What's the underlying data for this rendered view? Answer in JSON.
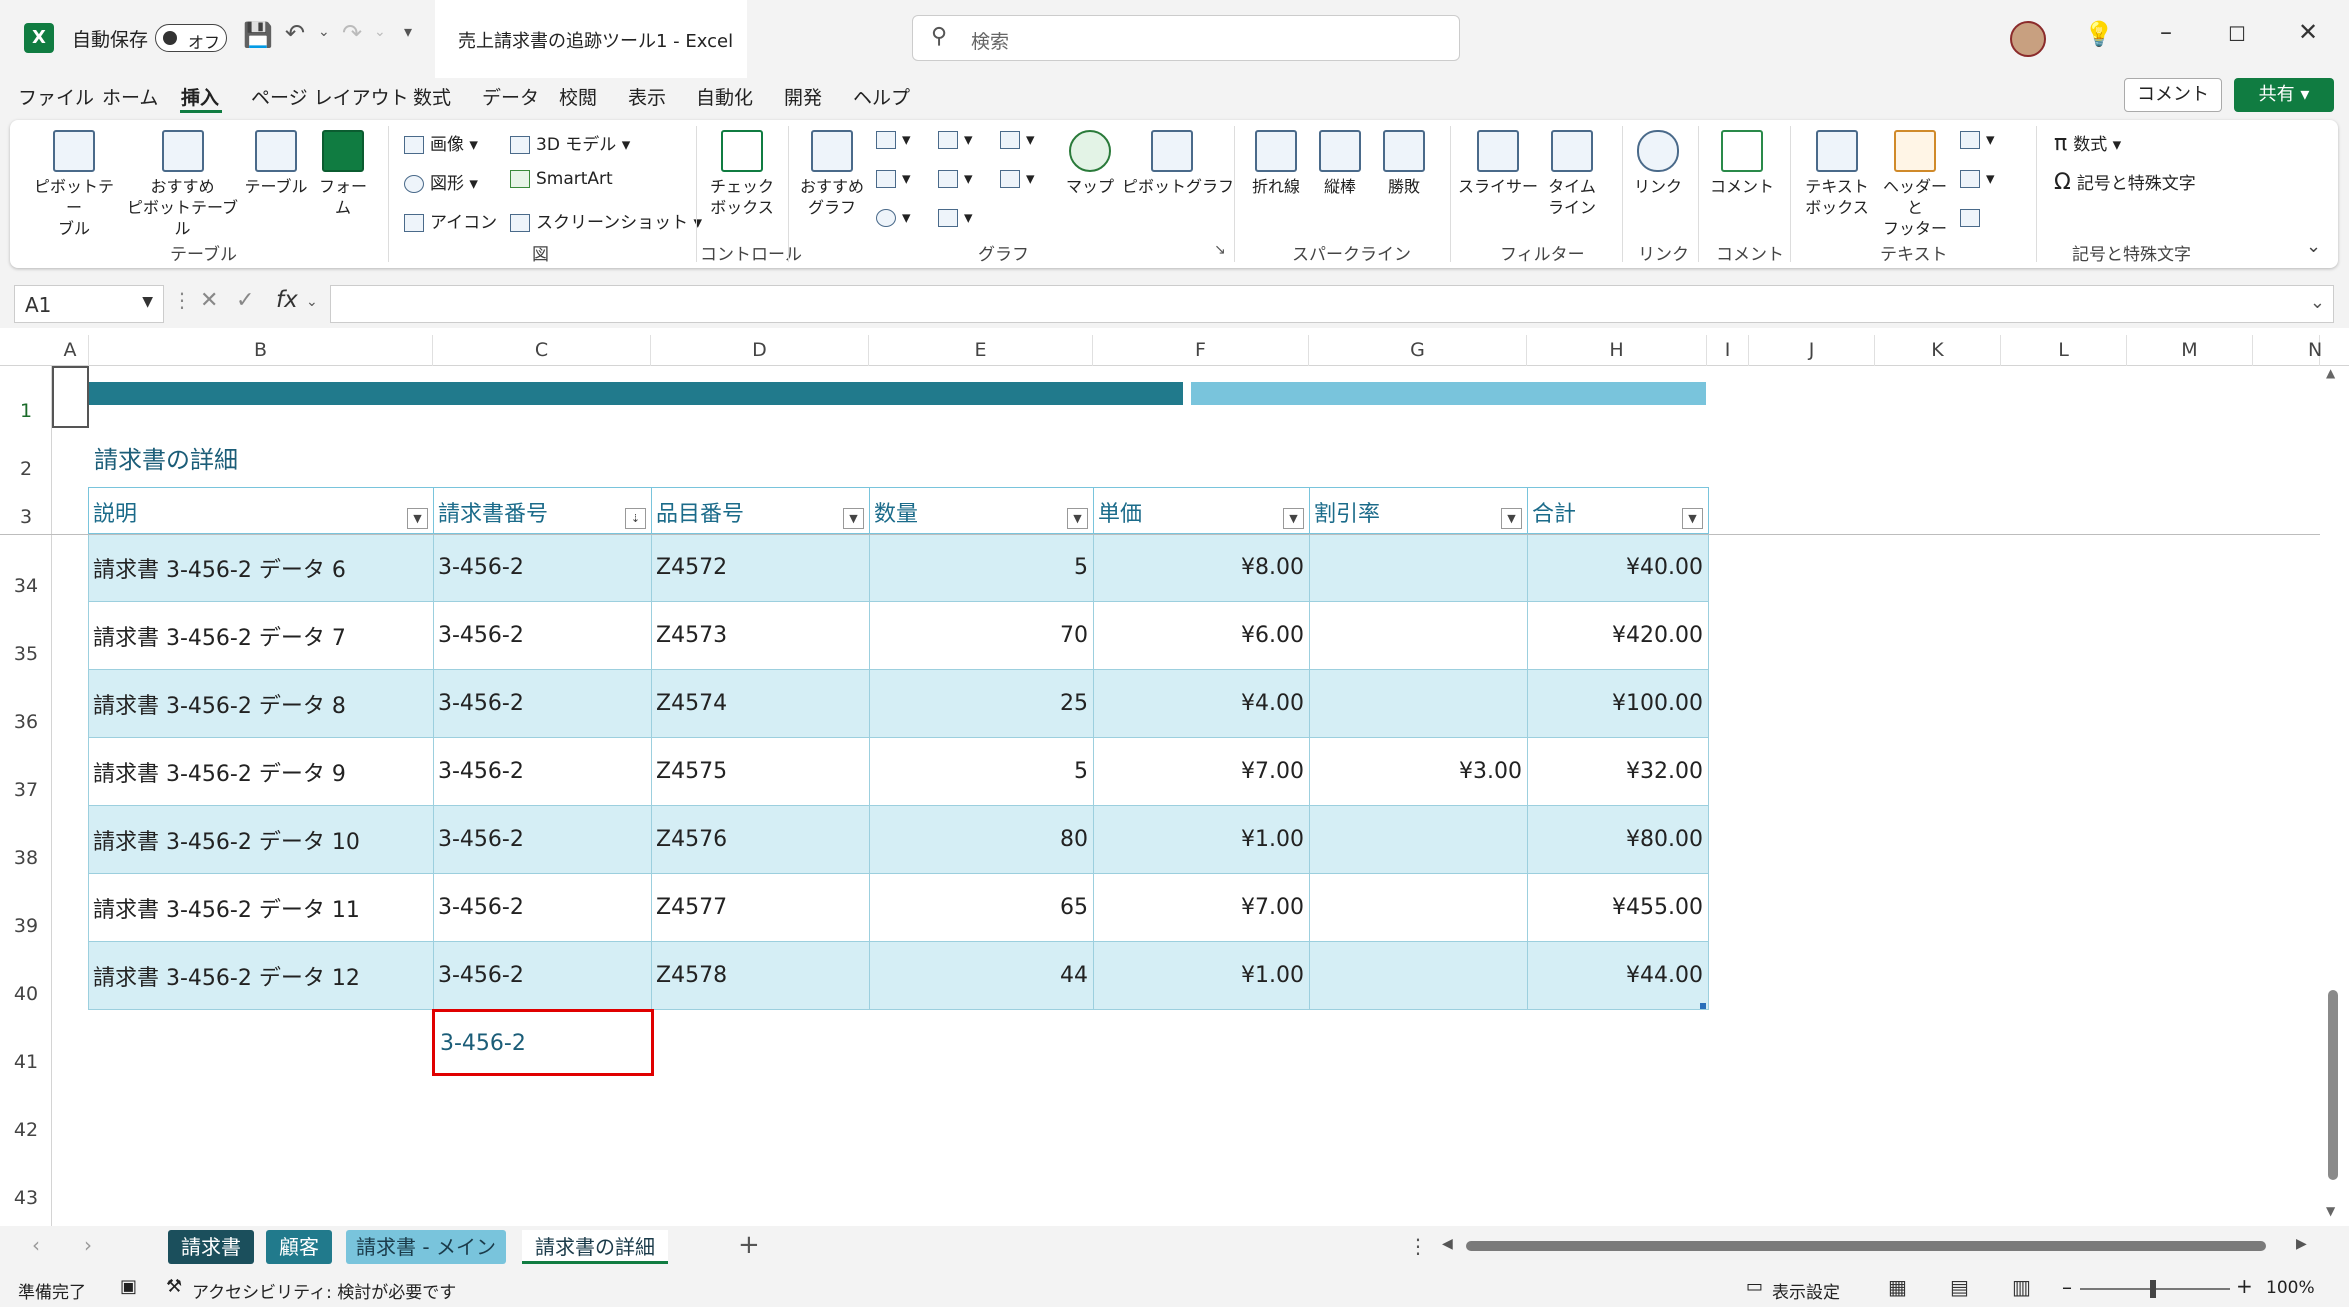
{
  "app": {
    "logo_letter": "X",
    "autosave_label": "自動保存",
    "autosave_state": "オフ",
    "document_title": "売上請求書の追跡ツール1  -  Excel",
    "search_placeholder": "検索"
  },
  "menu": [
    "ファイル",
    "ホーム",
    "挿入",
    "ページ レイアウト",
    "数式",
    "データ",
    "校閲",
    "表示",
    "自動化",
    "開発",
    "ヘルプ"
  ],
  "menu_active": "挿入",
  "header_buttons": {
    "comment": "コメント",
    "share": "共有"
  },
  "ribbon": {
    "pivot_table": "ピボットテー\nブル",
    "recommended_pivot": "おすすめ\nピボットテーブル",
    "table": "テーブル",
    "forms": "フォー\nム",
    "group_table": "テーブル",
    "image": "画像",
    "shapes": "図形",
    "icons": "アイコン",
    "model3d": "3D モデル",
    "smartart": "SmartArt",
    "screenshot": "スクリーンショット",
    "group_illust": "図",
    "checkbox": "チェック\nボックス",
    "group_control": "コントロール",
    "recommended_charts": "おすすめ\nグラフ",
    "maps": "マップ",
    "pivot_chart": "ピボットグラフ",
    "group_chart": "グラフ",
    "sparkline_line": "折れ線",
    "sparkline_column": "縦棒",
    "sparkline_winloss": "勝敗",
    "group_sparkline": "スパークライン",
    "slicer": "スライサー",
    "timeline": "タイム\nライン",
    "group_filter": "フィルター",
    "link": "リンク",
    "group_link": "リンク",
    "comment": "コメント",
    "group_comment": "コメント",
    "textbox": "テキスト\nボックス",
    "header_footer": "ヘッダーと\nフッター",
    "group_text": "テキスト",
    "equation": "数式",
    "symbol": "記号と特殊文字",
    "group_symbols": "記号と特殊文字"
  },
  "formula_bar": {
    "name_box": "A1",
    "fx": "fx",
    "formula": ""
  },
  "columns": [
    "A",
    "B",
    "C",
    "D",
    "E",
    "F",
    "G",
    "H",
    "I",
    "J",
    "K",
    "L",
    "M",
    "N"
  ],
  "rows": [
    "1",
    "2",
    "3",
    "34",
    "35",
    "36",
    "37",
    "38",
    "39",
    "40",
    "41",
    "42",
    "43"
  ],
  "sheet_title": "請求書の詳細",
  "table": {
    "headers": [
      "説明",
      "請求書番号",
      "品目番号",
      "数量",
      "単価",
      "割引率",
      "合計"
    ],
    "rows": [
      [
        "請求書 3-456-2 データ 6",
        "3-456-2",
        "Z4572",
        "5",
        "¥8.00",
        "",
        "¥40.00"
      ],
      [
        "請求書 3-456-2 データ 7",
        "3-456-2",
        "Z4573",
        "70",
        "¥6.00",
        "",
        "¥420.00"
      ],
      [
        "請求書 3-456-2 データ 8",
        "3-456-2",
        "Z4574",
        "25",
        "¥4.00",
        "",
        "¥100.00"
      ],
      [
        "請求書 3-456-2 データ 9",
        "3-456-2",
        "Z4575",
        "5",
        "¥7.00",
        "¥3.00",
        "¥32.00"
      ],
      [
        "請求書 3-456-2 データ 10",
        "3-456-2",
        "Z4576",
        "80",
        "¥1.00",
        "",
        "¥80.00"
      ],
      [
        "請求書 3-456-2 データ 11",
        "3-456-2",
        "Z4577",
        "65",
        "¥7.00",
        "",
        "¥455.00"
      ],
      [
        "請求書 3-456-2 データ 12",
        "3-456-2",
        "Z4578",
        "44",
        "¥1.00",
        "",
        "¥44.00"
      ]
    ]
  },
  "highlight_cell": {
    "ref": "C41",
    "value": "3-456-2"
  },
  "sheets": [
    {
      "label": "請求書",
      "active": false
    },
    {
      "label": "顧客",
      "active": false
    },
    {
      "label": "請求書 - メイン",
      "active": false
    },
    {
      "label": "請求書の詳細",
      "active": true
    }
  ],
  "status": {
    "ready": "準備完了",
    "accessibility": "アクセシビリティ: 検討が必要です",
    "display_settings": "表示設定",
    "zoom": "100%"
  },
  "colors": {
    "excel_green": "#107c41",
    "band_dark": "#217a8c",
    "band_light": "#79c4dc",
    "table_stripe": "#d5eef5",
    "highlight_red": "#e00000"
  }
}
